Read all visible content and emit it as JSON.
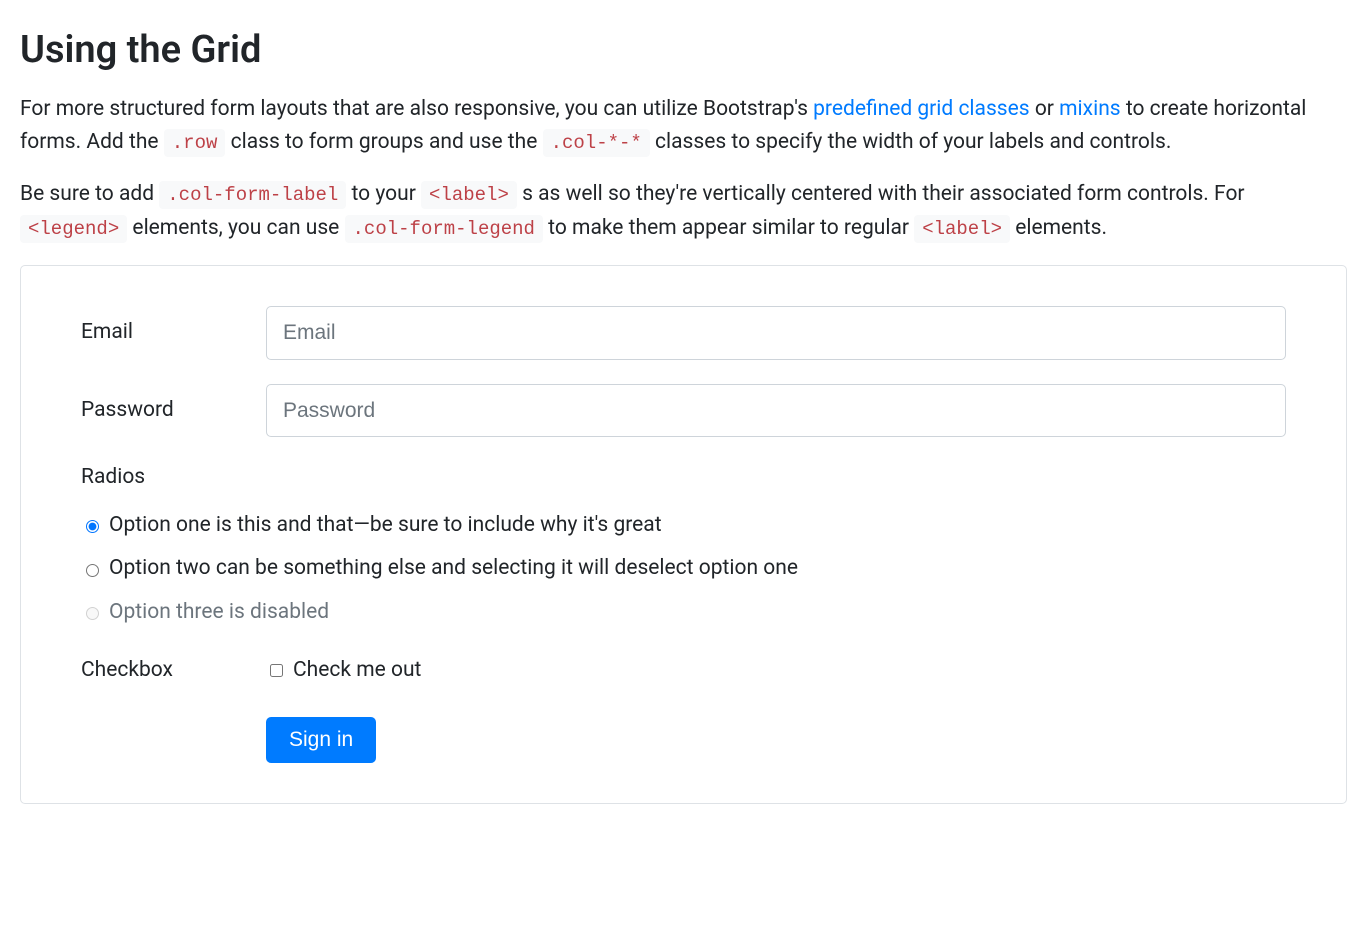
{
  "heading": "Using the Grid",
  "para1": {
    "t1": "For more structured form layouts that are also responsive, you can utilize Bootstrap's ",
    "link1": "predefined grid classes",
    "t2": " or ",
    "link2": "mixins",
    "t3": " to create horizontal forms. Add the ",
    "code1": ".row",
    "t4": " class to form groups and use the ",
    "code2": ".col-*-*",
    "t5": " classes to specify the width of your labels and controls."
  },
  "para2": {
    "t1": "Be sure to add ",
    "code1": ".col-form-label",
    "t2": " to your ",
    "code2": "<label>",
    "t3": " s as well so they're vertically centered with their associated form controls. For ",
    "code3": "<legend>",
    "t4": " elements, you can use ",
    "code4": ".col-form-legend",
    "t5": " to make them appear similar to regular ",
    "code5": "<label>",
    "t6": " elements."
  },
  "form": {
    "email_label": "Email",
    "email_placeholder": "Email",
    "password_label": "Password",
    "password_placeholder": "Password",
    "radios_legend": "Radios",
    "radio1": "Option one is this and that—be sure to include why it's great",
    "radio2": "Option two can be something else and selecting it will deselect option one",
    "radio3": "Option three is disabled",
    "checkbox_label": "Checkbox",
    "checkbox_text": "Check me out",
    "submit": "Sign in"
  }
}
